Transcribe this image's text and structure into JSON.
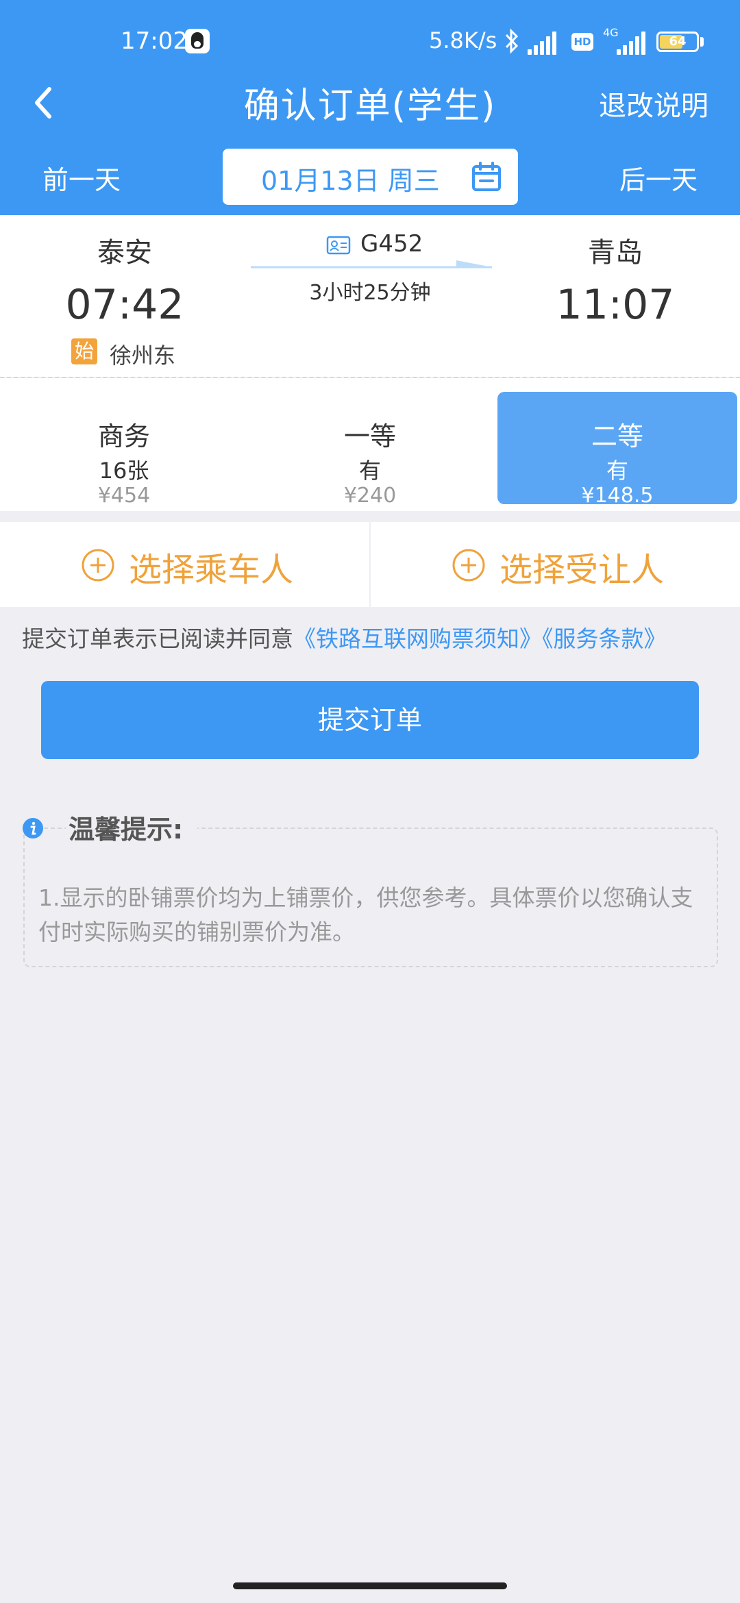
{
  "status_bar": {
    "time": "17:02",
    "net_speed": "5.8K/s",
    "network": "4G",
    "hd": "HD",
    "battery": "64",
    "battery_level": 0.64
  },
  "header": {
    "title": "确认订单(学生)",
    "refund_link": "退改说明",
    "prev_day": "前一天",
    "next_day": "后一天",
    "date": "01月13日 周三"
  },
  "train": {
    "from_station": "泰安",
    "to_station": "青岛",
    "departure_time": "07:42",
    "arrival_time": "11:07",
    "train_no": "G452",
    "duration": "3小时25分钟",
    "origin_badge": "始",
    "origin_station": "徐州东"
  },
  "seats": [
    {
      "name": "商务",
      "availability": "16张",
      "price": "¥454",
      "selected": false
    },
    {
      "name": "一等",
      "availability": "有",
      "price": "¥240",
      "selected": false
    },
    {
      "name": "二等",
      "availability": "有",
      "price": "¥148.5",
      "selected": true
    }
  ],
  "passenger": {
    "select_passenger": "选择乘车人",
    "select_beneficiary": "选择受让人"
  },
  "agreement": {
    "prefix": "提交订单表示已阅读并同意",
    "link1": "《铁路互联网购票须知》",
    "link2": "《服务条款》"
  },
  "submit_label": "提交订单",
  "tips": {
    "title": "温馨提示:",
    "content": "1.显示的卧铺票价均为上铺票价，供您参考。具体票价以您确认支付时实际购买的铺别票价为准。"
  },
  "colors": {
    "primary": "#3d98f4",
    "accent_orange": "#f0a23a",
    "selected_seat": "#5aa6f5",
    "background": "#eeeef3"
  }
}
